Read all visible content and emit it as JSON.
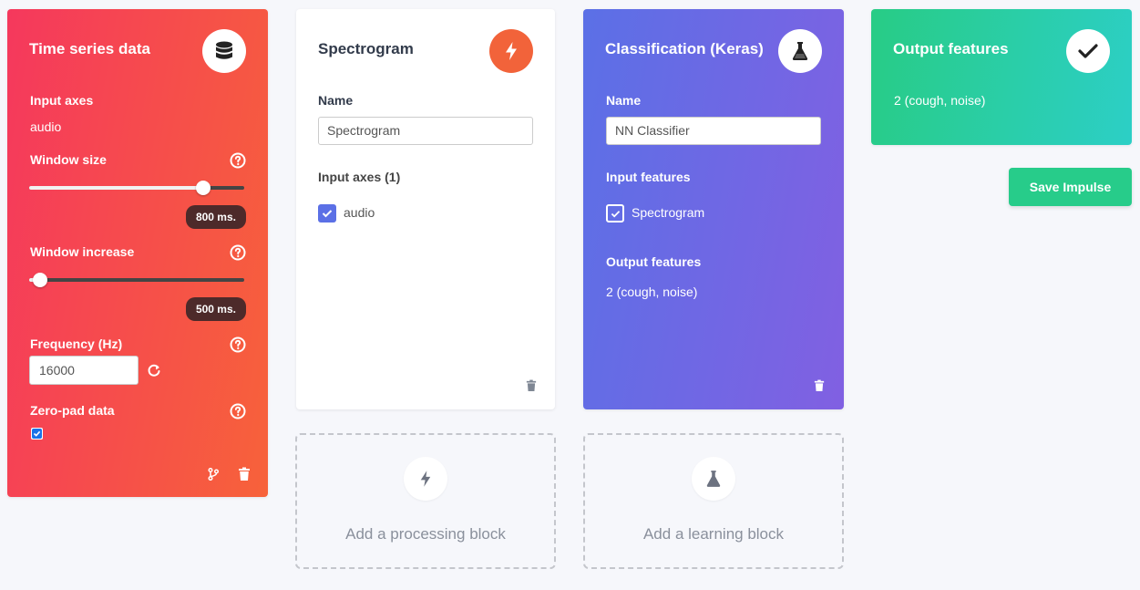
{
  "time_series": {
    "title": "Time series data",
    "input_axes_label": "Input axes",
    "input_axes_value": "audio",
    "window_size_label": "Window size",
    "window_size_value": "800 ms.",
    "window_size_fraction": 0.81,
    "window_increase_label": "Window increase",
    "window_increase_value": "500 ms.",
    "window_increase_fraction": 0.05,
    "frequency_label": "Frequency (Hz)",
    "frequency_value": "16000",
    "zero_pad_label": "Zero-pad data",
    "zero_pad_checked": true,
    "icon": "database-icon",
    "color_start": "#f5385d",
    "color_end": "#f7623a"
  },
  "spectrogram": {
    "title": "Spectrogram",
    "name_label": "Name",
    "name_value": "Spectrogram",
    "input_axes_label": "Input axes (1)",
    "axes": [
      {
        "label": "audio",
        "checked": true
      }
    ],
    "icon": "bolt-icon",
    "accent": "#f2633a"
  },
  "classification": {
    "title": "Classification (Keras)",
    "name_label": "Name",
    "name_value": "NN Classifier",
    "input_features_label": "Input features",
    "input_features": [
      {
        "label": "Spectrogram",
        "checked": true
      }
    ],
    "output_features_label": "Output features",
    "output_features_value": "2 (cough, noise)",
    "icon": "flask-icon",
    "color_start": "#5b70e6",
    "color_end": "#8160e2"
  },
  "output": {
    "title": "Output features",
    "value": "2 (cough, noise)",
    "icon": "check-icon"
  },
  "actions": {
    "save_label": "Save Impulse",
    "add_processing_label": "Add a processing block",
    "add_learning_label": "Add a learning block"
  }
}
